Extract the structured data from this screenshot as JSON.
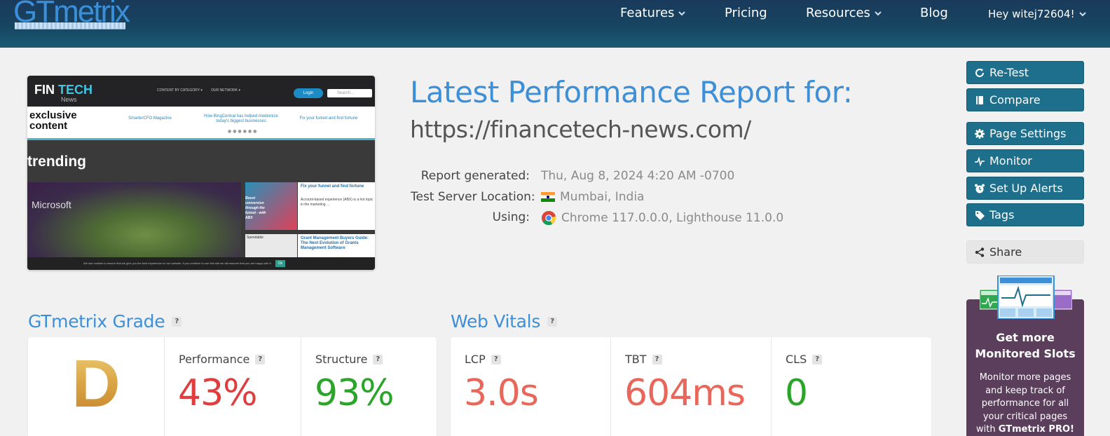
{
  "header": {
    "logo": "GTmetrix",
    "nav": {
      "features": "Features",
      "pricing": "Pricing",
      "resources": "Resources",
      "blog": "Blog",
      "user": "Hey witej72604!"
    }
  },
  "preview": {
    "brand_fin": "FIN",
    "brand_tech": "TECH",
    "brand_sub": "News",
    "menu_category": "CONTENT BY CATEGORY ▾",
    "menu_network": "OUR NETWORK ▾",
    "login": "Login",
    "search": "Search...",
    "exclusive_line1": "exclusive",
    "exclusive_line2": "content",
    "link1": "SmarterCFO Magazine",
    "link2": "How BingCentral has helped modernize today's biggest businesses",
    "link3": "Fix your funnel and find fortune",
    "trending": "trending",
    "microsoft": "Microsoft",
    "card1_img_text": "Boost conversion through the funnel - with ABX",
    "card1_title": "Fix your funnel and find fortune",
    "card1_text": "Account-based experience (ABX) is a hot topic in the marketing ...",
    "card2_img_text": "Spendable",
    "card2_title": "Grant Management Buyers Guide: The Next Evolution of Grants Management Software",
    "cookie_text": "We use cookies to ensure that we give you the best experience on our website. If you continue to use this site we will assume that you are happy with it.",
    "cookie_ok": "Ok"
  },
  "report": {
    "title": "Latest Performance Report for:",
    "url": "https://financetech-news.com/",
    "generated_label": "Report generated:",
    "generated_value": "Thu, Aug 8, 2024 4:20 AM -0700",
    "location_label": "Test Server Location:",
    "location_value": "Mumbai, India",
    "using_label": "Using:",
    "using_value": "Chrome 117.0.0.0, Lighthouse 11.0.0"
  },
  "sidebar": {
    "retest": "Re-Test",
    "compare": "Compare",
    "page_settings": "Page Settings",
    "monitor": "Monitor",
    "alerts": "Set Up Alerts",
    "tags": "Tags",
    "share": "Share"
  },
  "promo": {
    "title": "Get more Monitored Slots",
    "text": "Monitor more pages and keep track of performance for all your critical pages with",
    "text_bold": "GTmetrix PRO!"
  },
  "grade": {
    "title": "GTmetrix Grade",
    "letter": "D",
    "performance_label": "Performance",
    "performance_value": "43%",
    "structure_label": "Structure",
    "structure_value": "93%"
  },
  "vitals": {
    "title": "Web Vitals",
    "lcp_label": "LCP",
    "lcp_value": "3.0s",
    "tbt_label": "TBT",
    "tbt_value": "604ms",
    "cls_label": "CLS",
    "cls_value": "0"
  },
  "help_mark": "?",
  "colors": {
    "header": "#174560",
    "accent_blue": "#3d8fd8",
    "button_teal": "#1e6f8c",
    "bad_red": "#e03e3e",
    "good_green": "#2aa52a",
    "warn_salmon": "#e8675a",
    "grade_gold": "#d19632",
    "promo_purple": "#5a3e5c"
  }
}
